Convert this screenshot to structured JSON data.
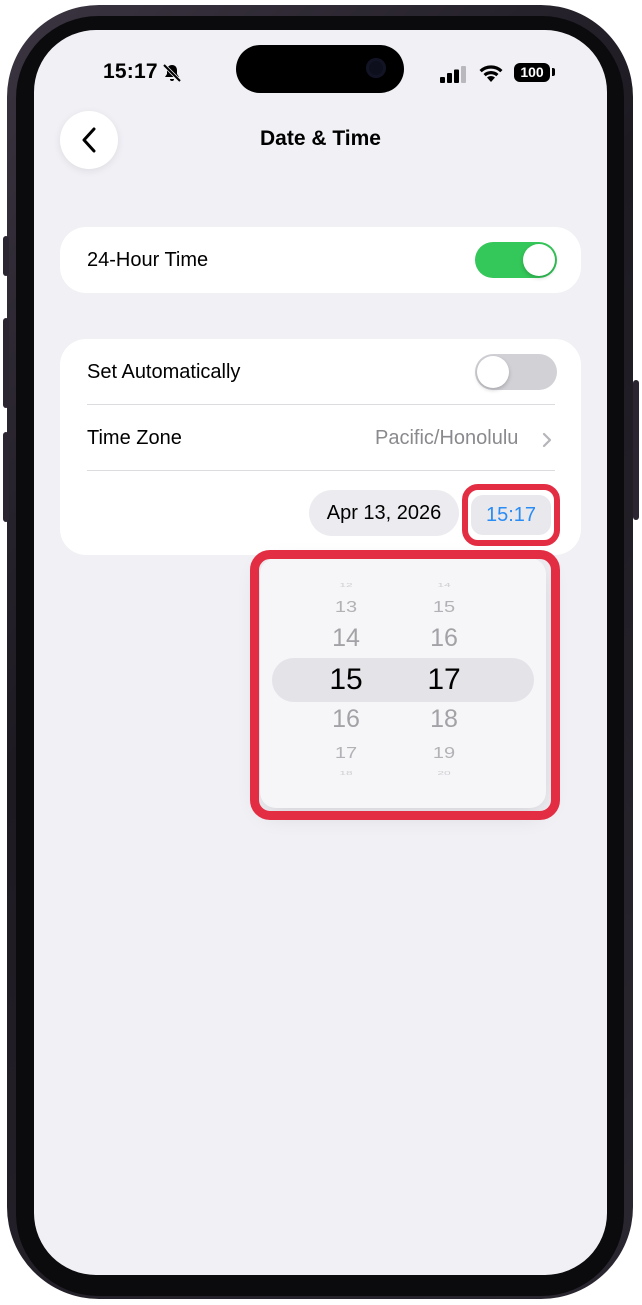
{
  "status_bar": {
    "time": "15:17",
    "battery": "100",
    "icons": [
      "bell-slash-icon",
      "cellular-signal-icon",
      "wifi-icon",
      "battery-icon"
    ]
  },
  "nav": {
    "back_icon": "chevron-left-icon",
    "title": "Date & Time"
  },
  "group1": {
    "label": "24-Hour Time",
    "toggle_on": true
  },
  "group2": {
    "set_auto_label": "Set Automatically",
    "set_auto_on": false,
    "timezone_label": "Time Zone",
    "timezone_value": "Pacific/Honolulu",
    "date_value": "Apr 13, 2026",
    "time_value": "15:17"
  },
  "picker": {
    "hours": [
      "12",
      "13",
      "14",
      "15",
      "16",
      "17",
      "18"
    ],
    "minutes": [
      "14",
      "15",
      "16",
      "17",
      "18",
      "19",
      "20"
    ],
    "selected_hour": "15",
    "selected_minute": "17"
  },
  "colors": {
    "toggle_on": "#34c759",
    "toggle_off": "#d1d1d6",
    "accent_blue": "#2a8cf5",
    "highlight_red": "#e32d43",
    "screen_bg": "#f0f0f5"
  }
}
